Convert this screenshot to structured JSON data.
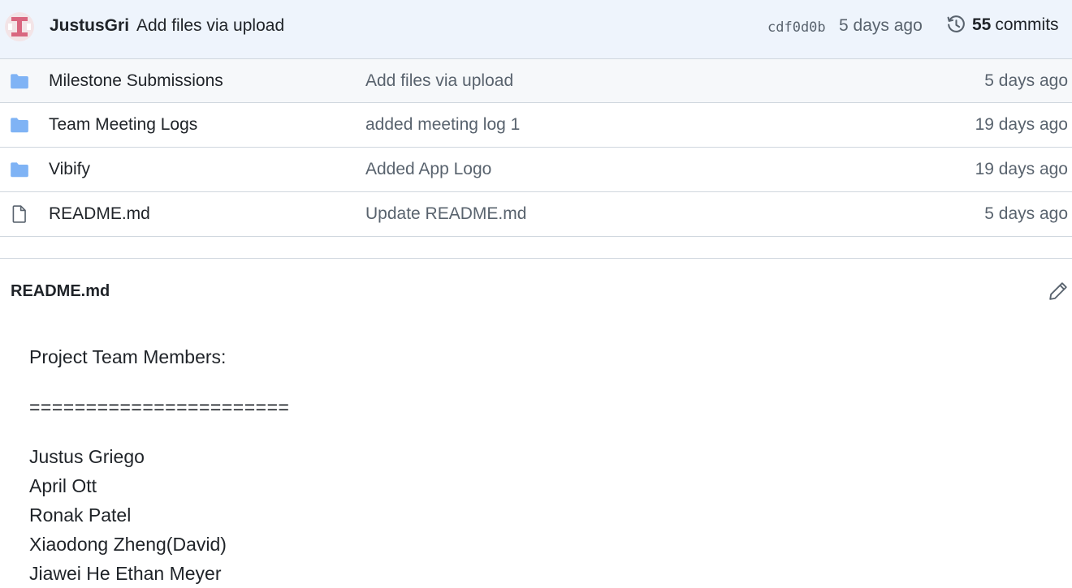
{
  "latest_commit": {
    "author": "JustusGri",
    "message": "Add files via upload",
    "sha": "cdf0d0b",
    "time": "5 days ago",
    "commits_count": "55",
    "commits_label": "commits"
  },
  "files": [
    {
      "name": "Milestone Submissions",
      "type": "folder",
      "message": "Add files via upload",
      "time": "5 days ago"
    },
    {
      "name": "Team Meeting Logs",
      "type": "folder",
      "message": "added meeting log 1",
      "time": "19 days ago"
    },
    {
      "name": "Vibify",
      "type": "folder",
      "message": "Added App Logo",
      "time": "19 days ago"
    },
    {
      "name": "README.md",
      "type": "file",
      "message": "Update README.md",
      "time": "5 days ago"
    }
  ],
  "readme": {
    "title": "README.md",
    "heading": "Project Team Members:",
    "rule": "=======================",
    "members": [
      "Justus Griego",
      "April Ott",
      "Ronak Patel",
      "Xiaodong Zheng(David)",
      "Jiawei He Ethan Meyer"
    ]
  },
  "colors": {
    "folder": "#7fb3f5",
    "header_bg": "#eef4fc",
    "muted_text": "#59636e",
    "border": "#d0d7de"
  }
}
